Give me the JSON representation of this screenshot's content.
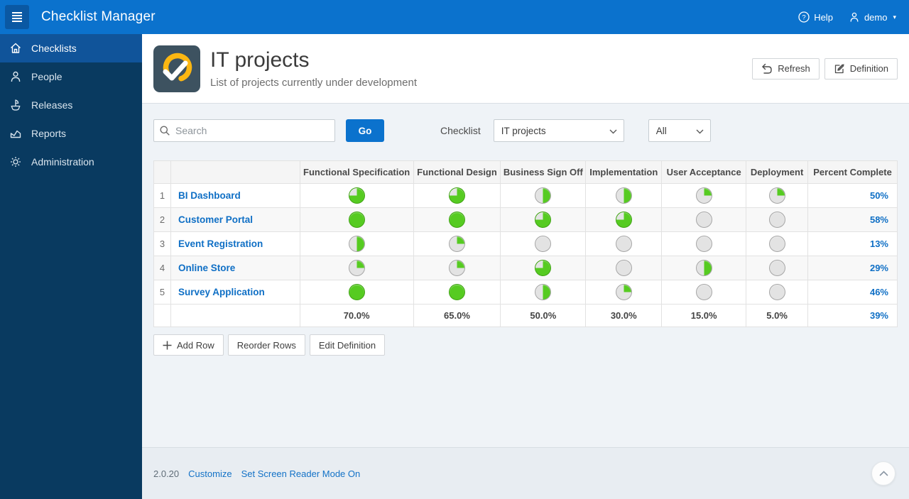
{
  "colors": {
    "header_blue": "#0b72cd",
    "sidebar_navy": "#093a60",
    "active_item_blue": "#10549a",
    "link_blue": "#0f6fc5",
    "pie_green": "#56cb21",
    "pie_green_border": "#3fa313",
    "pie_gray": "#e3e3e3",
    "pie_gray_border": "#a6a6a6",
    "icon_amber": "#fcb712",
    "icon_slate": "#3d5260"
  },
  "header": {
    "app_title": "Checklist Manager",
    "help_label": "Help",
    "user_label": "demo"
  },
  "sidebar": {
    "items": [
      {
        "label": "Checklists",
        "icon": "home-icon",
        "active": true
      },
      {
        "label": "People",
        "icon": "person-icon",
        "active": false
      },
      {
        "label": "Releases",
        "icon": "ship-icon",
        "active": false
      },
      {
        "label": "Reports",
        "icon": "chart-icon",
        "active": false
      },
      {
        "label": "Administration",
        "icon": "gear-icon",
        "active": false
      }
    ]
  },
  "page": {
    "title": "IT projects",
    "subtitle": "List of projects currently under development",
    "refresh_label": "Refresh",
    "definition_label": "Definition"
  },
  "filters": {
    "search_placeholder": "Search",
    "go_label": "Go",
    "checklist_label": "Checklist",
    "checklist_value": "IT projects",
    "scope_value": "All"
  },
  "table": {
    "columns": [
      "Functional Specification",
      "Functional Design",
      "Business Sign Off",
      "Implementation",
      "User Acceptance",
      "Deployment",
      "Percent Complete"
    ],
    "rows": [
      {
        "num": "1",
        "name": "BI Dashboard",
        "stages": [
          75,
          75,
          50,
          50,
          25,
          25
        ],
        "percent": "50%"
      },
      {
        "num": "2",
        "name": "Customer Portal",
        "stages": [
          100,
          100,
          75,
          75,
          0,
          0
        ],
        "percent": "58%"
      },
      {
        "num": "3",
        "name": "Event Registration",
        "stages": [
          50,
          25,
          0,
          0,
          0,
          0
        ],
        "percent": "13%"
      },
      {
        "num": "4",
        "name": "Online Store",
        "stages": [
          25,
          25,
          75,
          0,
          50,
          0
        ],
        "percent": "29%"
      },
      {
        "num": "5",
        "name": "Survey Application",
        "stages": [
          100,
          100,
          50,
          25,
          0,
          0
        ],
        "percent": "46%"
      }
    ],
    "totals": [
      "70.0%",
      "65.0%",
      "50.0%",
      "30.0%",
      "15.0%",
      "5.0%",
      "39%"
    ]
  },
  "actions": {
    "add_row": "Add Row",
    "reorder_rows": "Reorder Rows",
    "edit_definition": "Edit Definition"
  },
  "footer": {
    "version": "2.0.20",
    "customize": "Customize",
    "screen_reader": "Set Screen Reader Mode On"
  }
}
